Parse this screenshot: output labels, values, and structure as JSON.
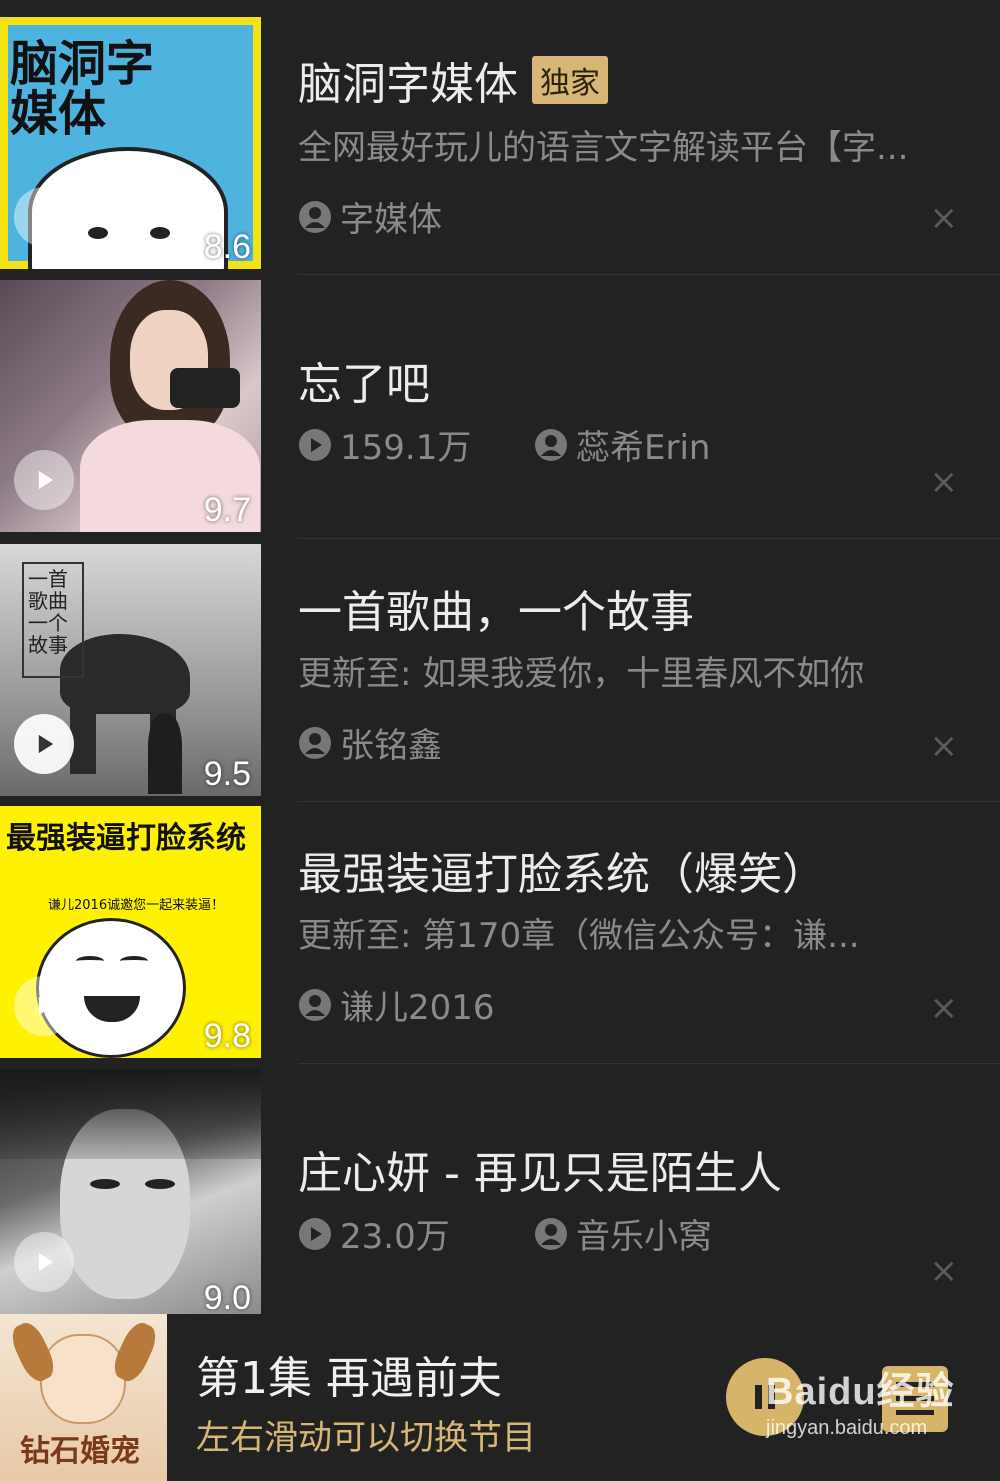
{
  "items": [
    {
      "title": "脑洞字媒体",
      "badge": "独家",
      "desc": "全网最好玩儿的语言文字解读平台【字...",
      "author": "字媒体",
      "score": "8.6",
      "thumb_text": "脑洞字媒体",
      "close": "×"
    },
    {
      "title": "忘了吧",
      "plays": "159.1万",
      "author": "蕊希Erin",
      "score": "9.7",
      "close": "×"
    },
    {
      "title": "一首歌曲，一个故事",
      "desc": "更新至: 如果我爱你，十里春风不如你",
      "author": "张铭鑫",
      "score": "9.5",
      "thumb_text": "一首歌曲 一个故事",
      "close": "×"
    },
    {
      "title": "最强装逼打脸系统（爆笑）",
      "desc": "更新至: 第170章（微信公众号：谦...",
      "author": "谦儿2016",
      "score": "9.8",
      "thumb_text_1": "最强装逼打脸系统",
      "thumb_text_2": "谦儿2016诚邀您一起来装逼！",
      "close": "×"
    },
    {
      "title": "庄心妍 - 再见只是陌生人",
      "plays": "23.0万",
      "author": "音乐小窝",
      "score": "9.0",
      "close": "×"
    }
  ],
  "player": {
    "title": "第1集 再遇前夫",
    "hint": "左右滑动可以切换节目",
    "cover_text": "钻石婚宠"
  },
  "watermark": {
    "line1": "Baidu经验",
    "line2": "jingyan.baidu.com"
  },
  "colors": {
    "background": "#222222",
    "accent": "#d8b676",
    "muted_text": "#8a8a8a"
  }
}
